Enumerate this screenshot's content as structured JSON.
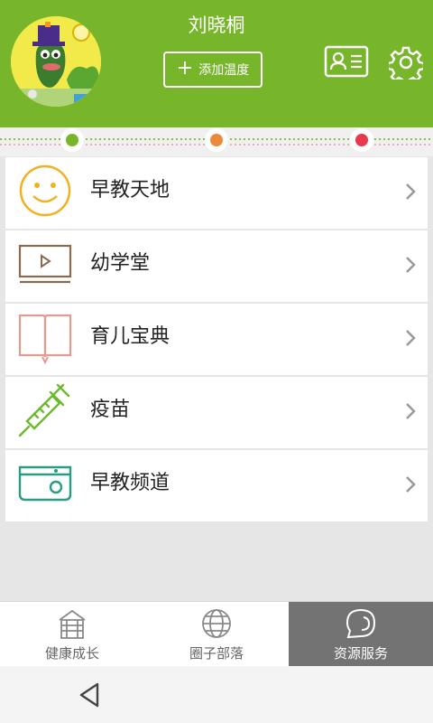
{
  "header": {
    "user_name": "刘晓桐",
    "add_temp_label": "添加温度",
    "bg_color": "#77b52b",
    "icons": [
      "avatar",
      "id-card-icon",
      "gear-icon"
    ]
  },
  "timeline": {
    "dots": [
      {
        "color": "#77b52b"
      },
      {
        "color": "#ec8a3c"
      },
      {
        "color": "#e83a4a"
      }
    ]
  },
  "menu": {
    "items": [
      {
        "label": "早教天地",
        "icon": "smiley-icon",
        "icon_color": "#f3b11f"
      },
      {
        "label": "幼学堂",
        "icon": "video-icon",
        "icon_color": "#8b6b4e"
      },
      {
        "label": "育儿宝典",
        "icon": "open-book-icon",
        "icon_color": "#e39a8f"
      },
      {
        "label": "疫苗",
        "icon": "syringe-icon",
        "icon_color": "#6cba2c"
      },
      {
        "label": "早教频道",
        "icon": "tv-box-icon",
        "icon_color": "#2a9b85"
      }
    ]
  },
  "bottom_nav": {
    "tabs": [
      {
        "label": "健康成长",
        "icon": "house-icon",
        "active": false
      },
      {
        "label": "圈子部落",
        "icon": "globe-icon",
        "active": false
      },
      {
        "label": "资源服务",
        "icon": "chat-bubble-icon",
        "active": true
      }
    ]
  },
  "system_nav": {
    "back_icon": "back-triangle-icon"
  }
}
